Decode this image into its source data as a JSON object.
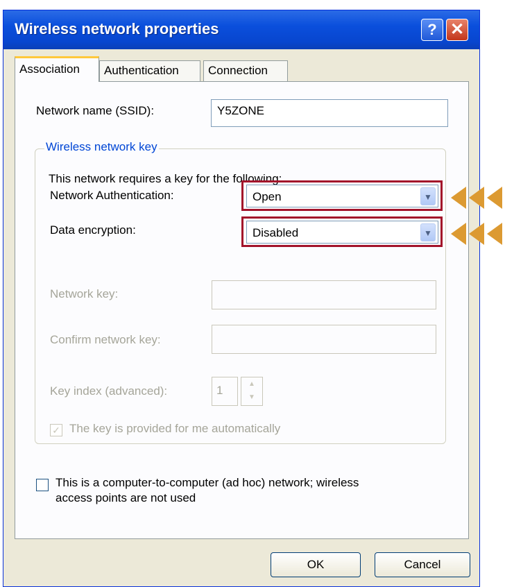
{
  "window": {
    "title": "Wireless network properties"
  },
  "titlebar": {
    "help_label": "?",
    "close_label": "✕"
  },
  "tabs": [
    {
      "label": "Association",
      "active": true
    },
    {
      "label": "Authentication",
      "active": false
    },
    {
      "label": "Connection",
      "active": false
    }
  ],
  "association": {
    "ssid_label": "Network name (SSID):",
    "ssid_value": "Y5ZONE",
    "group_title": "Wireless network key",
    "requires_text": "This network requires a key for the following:",
    "auth_label": "Network Authentication:",
    "auth_value": "Open",
    "encryption_label": "Data encryption:",
    "encryption_value": "Disabled",
    "network_key_label": "Network key:",
    "confirm_key_label": "Confirm network key:",
    "key_index_label": "Key index (advanced):",
    "key_index_value": "1",
    "auto_key_label": "The key is provided for me automatically",
    "auto_key_checked": true,
    "adhoc_label_line1": "This is a computer-to-computer (ad hoc) network; wireless",
    "adhoc_label_line2": "access points are not used",
    "adhoc_checked": false
  },
  "buttons": {
    "ok": "OK",
    "cancel": "Cancel"
  },
  "annotation_color": "#dc9a32",
  "highlight_color": "#a3132a"
}
